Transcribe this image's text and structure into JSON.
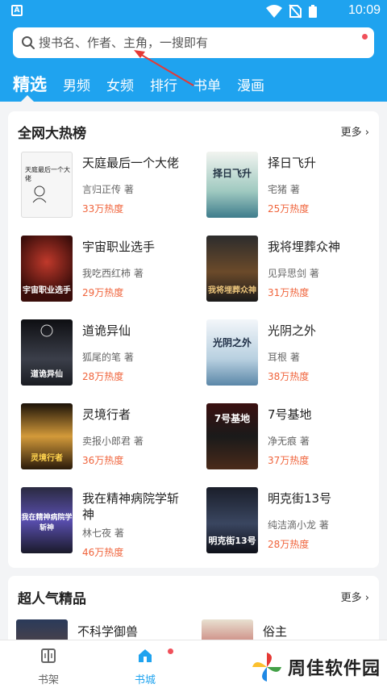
{
  "status_bar": {
    "time": "10:09"
  },
  "search": {
    "placeholder": "搜书名、作者、主角，一搜即有"
  },
  "tabs": [
    {
      "label": "精选",
      "active": true
    },
    {
      "label": "男频"
    },
    {
      "label": "女频"
    },
    {
      "label": "排行"
    },
    {
      "label": "书单"
    },
    {
      "label": "漫画"
    }
  ],
  "hot_list": {
    "title": "全网大热榜",
    "more_label": "更多",
    "books": [
      {
        "title": "天庭最后一个大佬",
        "author": "言归正传 著",
        "heat": "33万热度"
      },
      {
        "title": "择日飞升",
        "author": "宅猪 著",
        "heat": "25万热度"
      },
      {
        "title": "宇宙职业选手",
        "author": "我吃西红柿 著",
        "heat": "29万热度"
      },
      {
        "title": "我将埋葬众神",
        "author": "见异思剑 著",
        "heat": "31万热度"
      },
      {
        "title": "道诡异仙",
        "author": "狐尾的笔 著",
        "heat": "28万热度"
      },
      {
        "title": "光阴之外",
        "author": "耳根 著",
        "heat": "38万热度"
      },
      {
        "title": "灵境行者",
        "author": "卖报小郎君 著",
        "heat": "36万热度"
      },
      {
        "title": "7号基地",
        "author": "净无痕 著",
        "heat": "37万热度"
      },
      {
        "title": "我在精神病院学斩神",
        "author": "林七夜 著",
        "heat": "46万热度"
      },
      {
        "title": "明克街13号",
        "author": "纯洁滴小龙 著",
        "heat": "28万热度"
      }
    ]
  },
  "popular": {
    "title": "超人气精品",
    "more_label": "更多",
    "books": [
      {
        "title": "不科学御兽"
      },
      {
        "title": "俗主"
      }
    ]
  },
  "bottom_nav": [
    {
      "label": "书架"
    },
    {
      "label": "书城",
      "active": true
    }
  ],
  "watermark": {
    "text": "周佳软件园"
  },
  "colors": {
    "header_blue": "#1fa3ef",
    "heat_orange": "#f0643c",
    "badge_red": "#f0505a"
  }
}
